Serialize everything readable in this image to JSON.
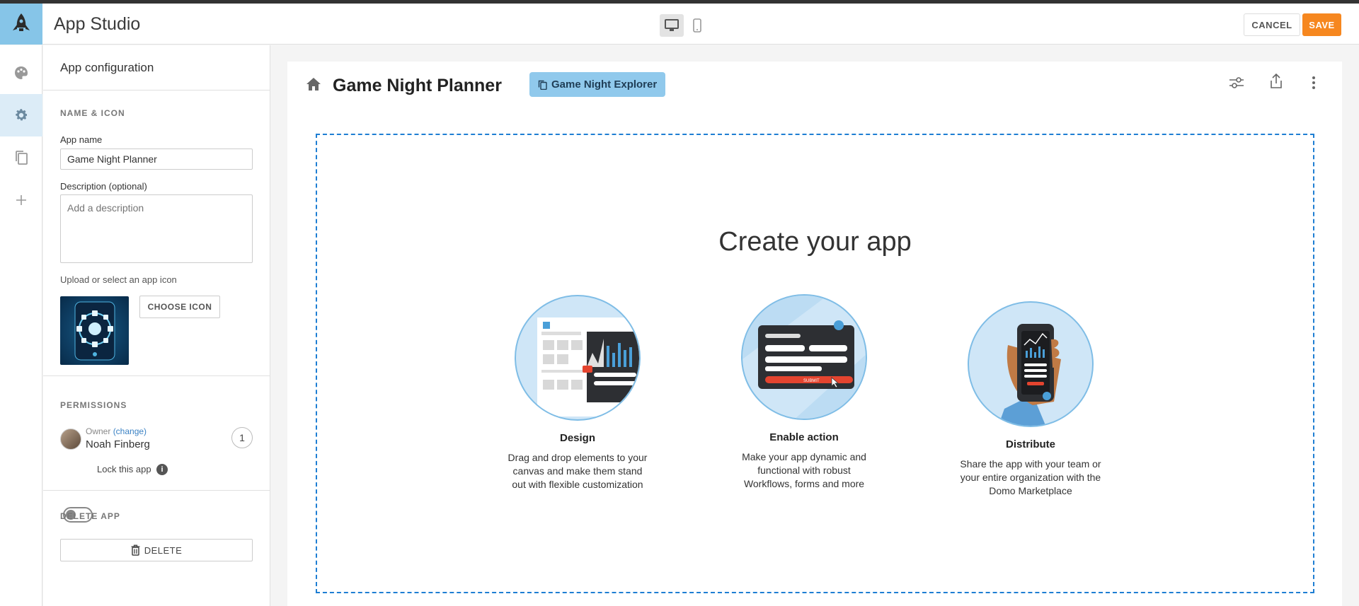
{
  "header": {
    "app_title": "App Studio",
    "cancel_label": "CANCEL",
    "save_label": "SAVE",
    "accent": "#f6871f"
  },
  "rail": {
    "items": [
      {
        "icon": "palette-icon"
      },
      {
        "icon": "gear-icon",
        "active": true
      },
      {
        "icon": "copy-pages-icon"
      },
      {
        "icon": "plus-icon"
      }
    ]
  },
  "config": {
    "title": "App configuration",
    "name_icon_section": "NAME & ICON",
    "app_name_label": "App name",
    "app_name_value": "Game Night Planner",
    "description_label": "Description (optional)",
    "description_placeholder": "Add a description",
    "upload_label": "Upload or select an app icon",
    "choose_icon_label": "CHOOSE ICON",
    "permissions_section": "PERMISSIONS",
    "owner_label": "Owner",
    "owner_change": "(change)",
    "owner_name": "Noah Finberg",
    "owner_count": "1",
    "lock_label": "Lock this app",
    "lock_on": false,
    "delete_section": "DELETE APP",
    "delete_label": "DELETE"
  },
  "canvas": {
    "page_title": "Game Night Planner",
    "chip_label": "Game Night Explorer",
    "create_title": "Create your app",
    "features": [
      {
        "title": "Design",
        "desc": "Drag and drop elements to your canvas and make them stand out with flexible customization"
      },
      {
        "title": "Enable action",
        "desc": "Make your app dynamic and functional with robust Workflows, forms and more"
      },
      {
        "title": "Distribute",
        "desc": "Share the app with your team or your entire organization with the Domo Marketplace"
      }
    ]
  }
}
